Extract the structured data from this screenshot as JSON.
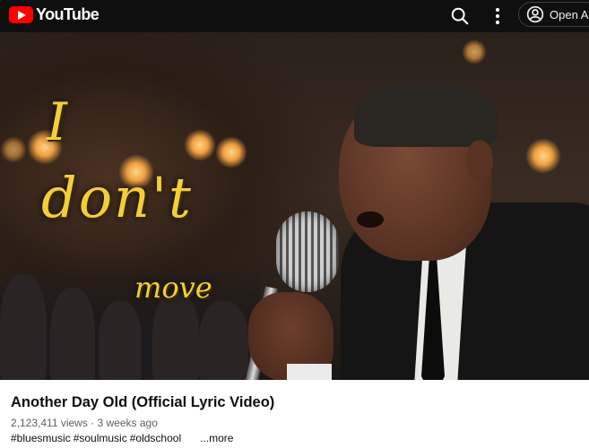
{
  "header": {
    "logo_text": "YouTube",
    "search_icon": "search-icon",
    "more_icon": "more-vert-icon",
    "open_app_label": "Open Ap",
    "open_app_icon": "account-circle-icon"
  },
  "video": {
    "lyrics": [
      "I",
      "don't",
      "move"
    ],
    "lyric_color": "#f2cf3a"
  },
  "details": {
    "title": "Another Day Old (Official Lyric Video)",
    "meta": "2,123,411 views · 3 weeks ago",
    "tags": [
      "#bluesmusic",
      "#soulmusic",
      "#oldschool"
    ],
    "more_label": "...more"
  },
  "colors": {
    "header_bg": "#0f0f0f",
    "brand_red": "#ff0000",
    "text_primary": "#0f0f0f",
    "text_secondary": "#606060"
  }
}
